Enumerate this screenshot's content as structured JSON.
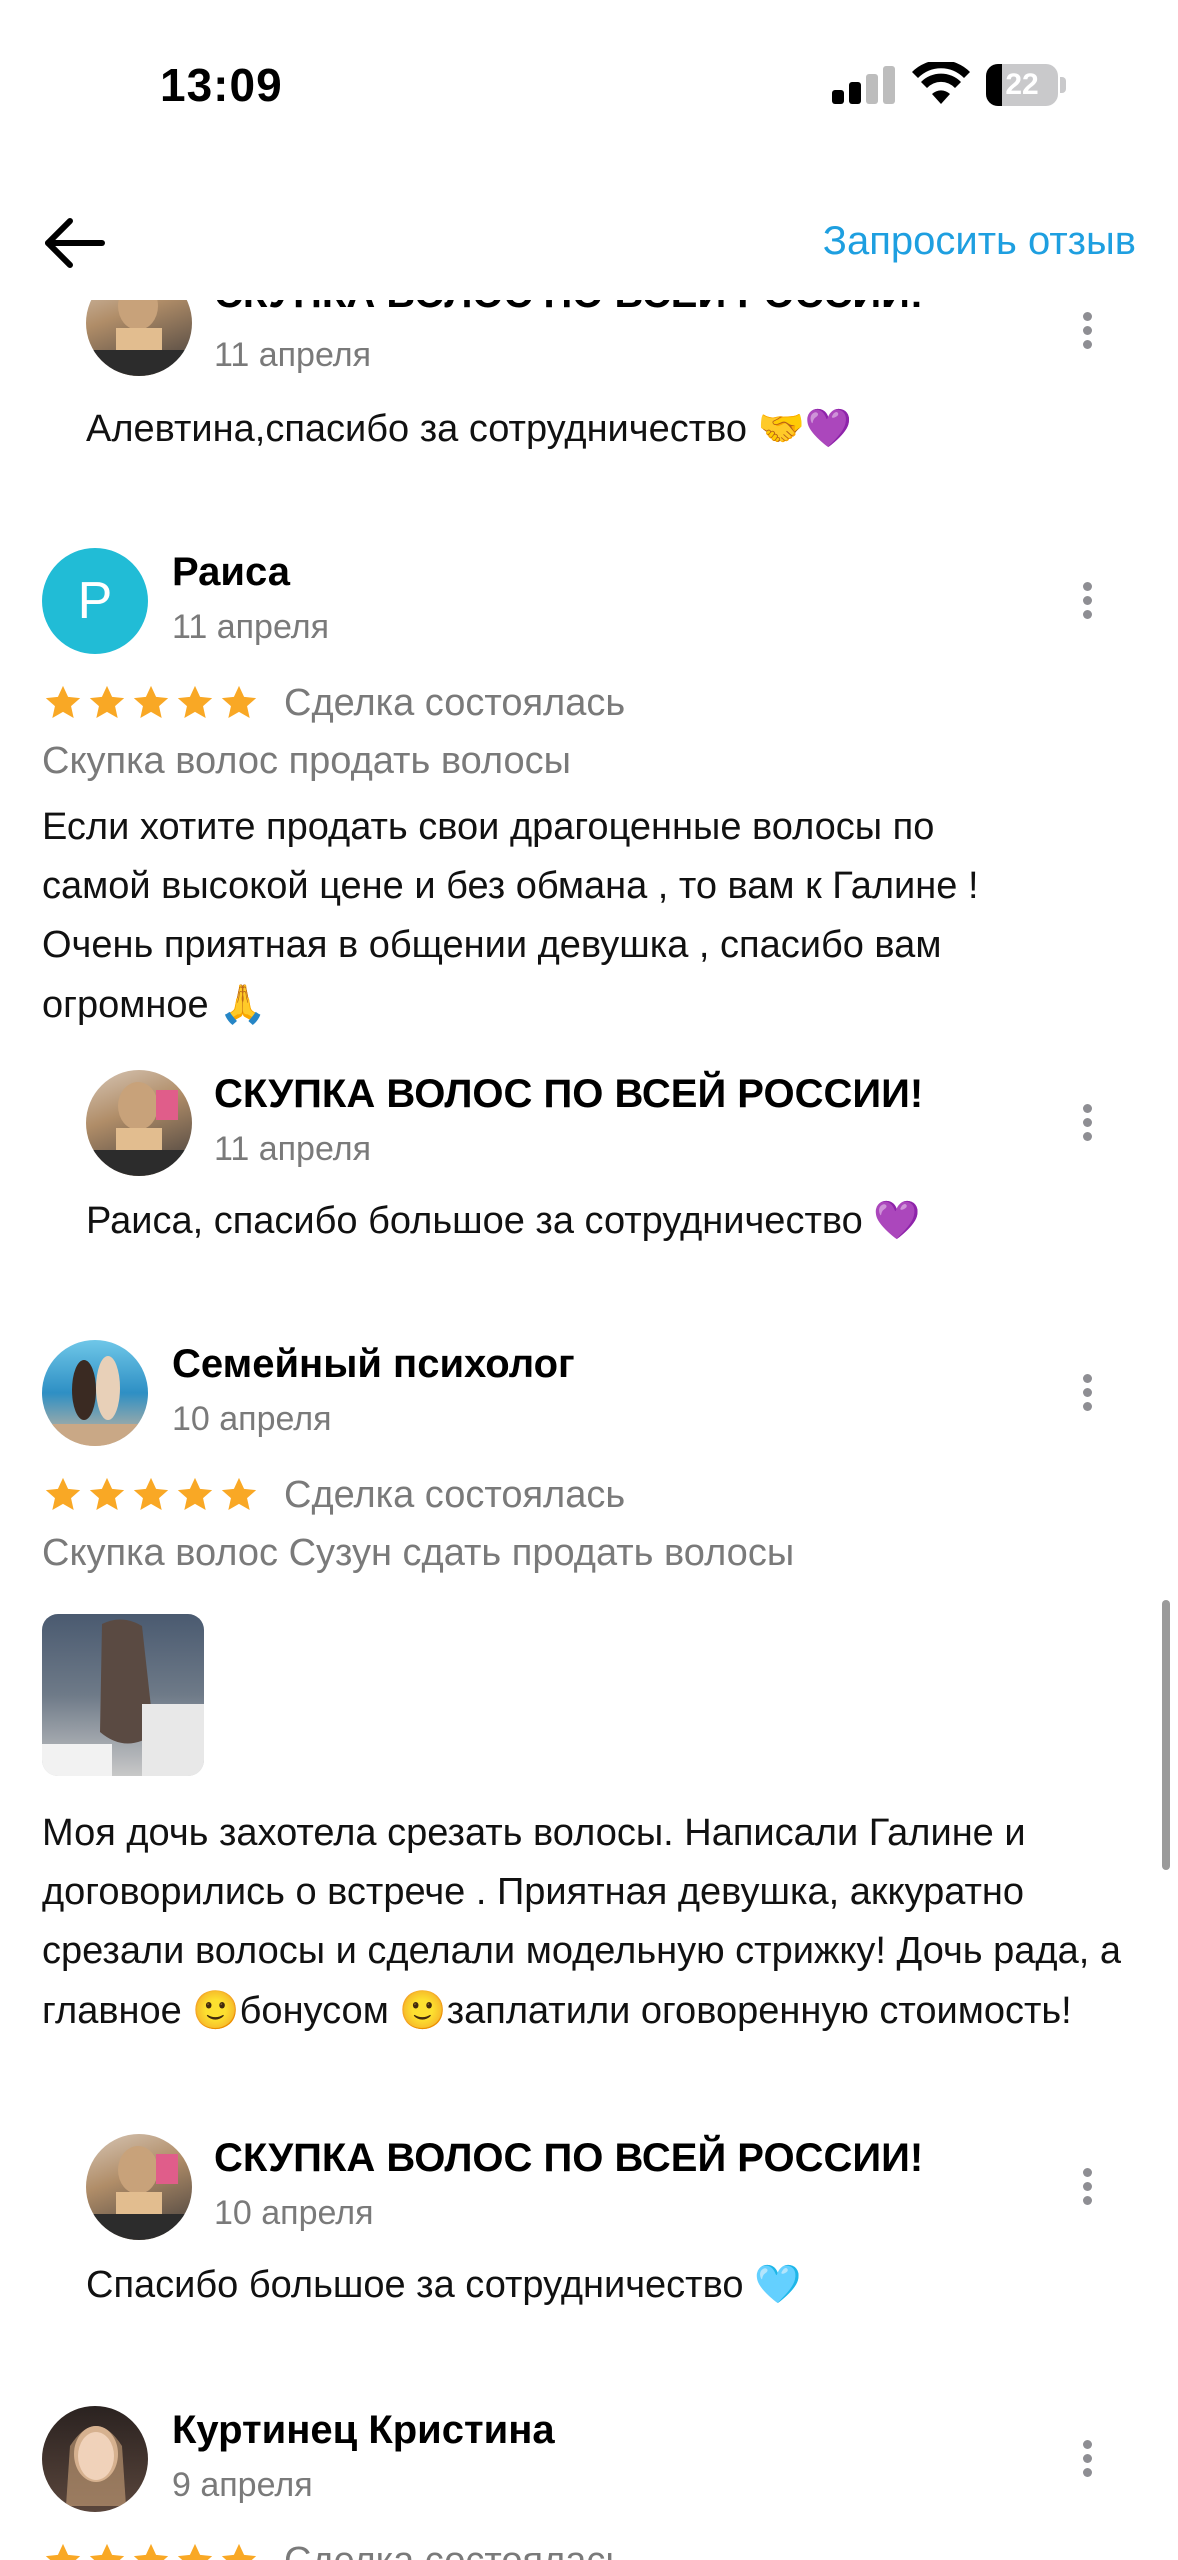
{
  "status_bar": {
    "time": "13:09",
    "battery": "22",
    "battery_level_percent": 22
  },
  "nav": {
    "request_review": "Запросить отзыв",
    "back_icon": "arrow-left-icon"
  },
  "colors": {
    "accent": "#1e9fe0",
    "star": "#f9a825",
    "avatar_p": "#21bcd6",
    "muted": "#7a7a7a"
  },
  "reviews": [
    {
      "reply": {
        "author": "СКУПКА ВОЛОС ПО ВСЕЙ РОССИИ!",
        "date": "11 апреля",
        "text": "Алевтина,спасибо за сотрудничество",
        "emoji": "🤝💜"
      }
    },
    {
      "author": "Раиса",
      "avatar_letter": "Р",
      "date": "11 апреля",
      "rating": 5,
      "deal": "Сделка состоялась",
      "subject": "Скупка волос продать волосы",
      "text": "Если хотите продать свои драгоценные волосы по самой высокой цене и без обмана , то вам к Галине ! Очень приятная в общении девушка , спасибо вам огромное",
      "text_emoji": "🙏",
      "reply": {
        "author": "СКУПКА ВОЛОС ПО ВСЕЙ РОССИИ!",
        "date": "11 апреля",
        "text": "Раиса, спасибо большое за сотрудничество",
        "emoji": "💜"
      }
    },
    {
      "author": "Семейный психолог",
      "date": "10 апреля",
      "rating": 5,
      "deal": "Сделка состоялась",
      "subject": "Скупка волос Сузун сдать продать волосы",
      "text_parts": [
        "Моя дочь захотела срезать волосы. Написали Галине и договорились о встрече . Приятная девушка, аккуратно срезали волосы и сделали модельную стрижку! Дочь рада, а главное ",
        "бонусом ",
        "заплатили оговоренную стоимость!"
      ],
      "text_emoji": "🙂",
      "reply": {
        "author": "СКУПКА ВОЛОС ПО ВСЕЙ РОССИИ!",
        "date": "10 апреля",
        "text": "Спасибо большое за сотрудничество",
        "emoji": "🩵"
      }
    },
    {
      "author": "Куртинец Кристина",
      "date": "9 апреля",
      "rating": 5,
      "deal": "Сделка состоялась"
    }
  ]
}
